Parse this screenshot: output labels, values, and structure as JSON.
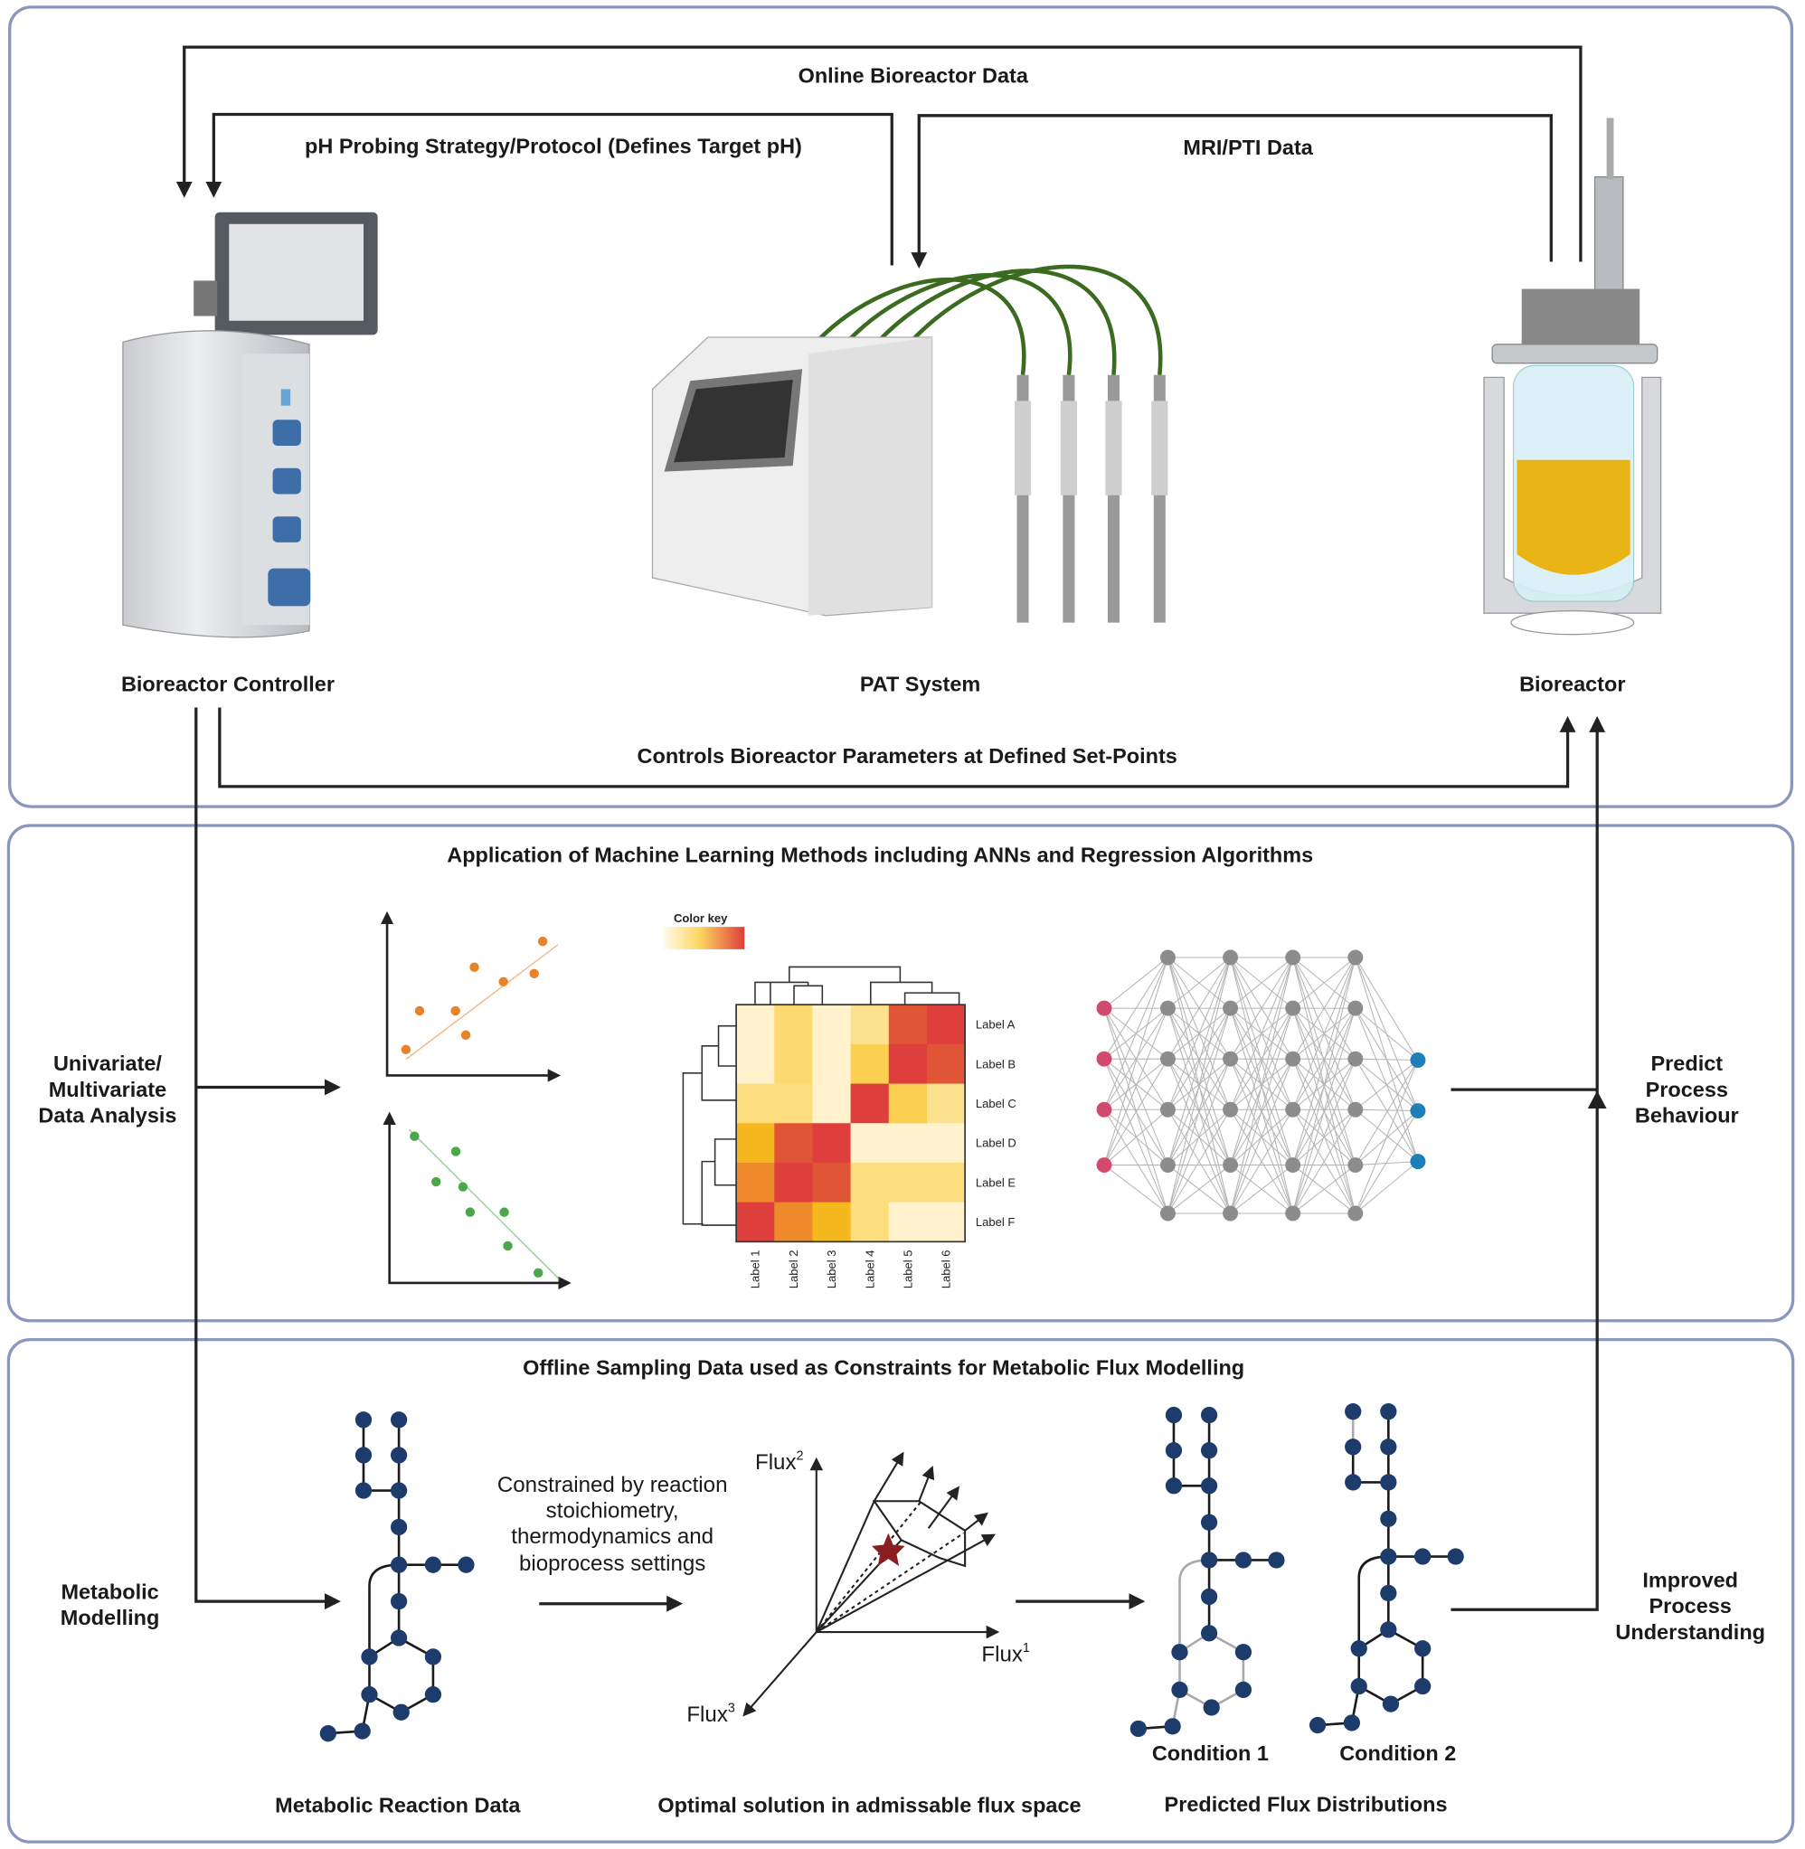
{
  "panels": {
    "top": {
      "arrows": {
        "online": "Online Bioreactor Data",
        "ph": "pH Probing Strategy/Protocol (Defines Target pH)",
        "mri": "MRI/PTI Data",
        "controls": "Controls Bioreactor Parameters at Defined Set-Points"
      },
      "devices": {
        "controller": "Bioreactor Controller",
        "pat": "PAT System",
        "bioreactor": "Bioreactor"
      }
    },
    "middle": {
      "title": "Application of Machine Learning Methods including ANNs and Regression Algorithms",
      "left_label": [
        "Univariate/",
        "Multivariate",
        "Data Analysis"
      ],
      "right_label": [
        "Predict",
        "Process",
        "Behaviour"
      ]
    },
    "bottom": {
      "title": "Offline Sampling Data used as Constraints for Metabolic Flux Modelling",
      "left_label": [
        "Metabolic",
        "Modelling"
      ],
      "right_label": [
        "Improved",
        "Process",
        "Understanding"
      ],
      "constraint_text": [
        "Constrained by reaction",
        "stoichiometry,",
        "thermodynamics and",
        "bioprocess settings"
      ],
      "flux_axes": {
        "x": "Flux",
        "x_sup": "1",
        "y": "Flux",
        "y_sup": "2",
        "z": "Flux",
        "z_sup": "3"
      },
      "conditions": [
        "Condition 1",
        "Condition 2"
      ],
      "captions": {
        "reaction": "Metabolic Reaction Data",
        "optimal": "Optimal solution in admissable flux space",
        "predicted": "Predicted Flux Distributions"
      }
    }
  },
  "chart_data": [
    {
      "type": "scatter",
      "title": "",
      "xlim": [
        0,
        10
      ],
      "ylim": [
        0,
        10
      ],
      "color": "#e8832b",
      "x": [
        1.1,
        1.9,
        4.0,
        4.6,
        5.1,
        6.8,
        8.6,
        9.1
      ],
      "y": [
        1.6,
        4.0,
        4.0,
        2.5,
        6.7,
        5.8,
        6.3,
        8.3
      ],
      "trend": [
        [
          1.1,
          1.0
        ],
        [
          10,
          8.1
        ]
      ]
    },
    {
      "type": "scatter",
      "title": "",
      "xlim": [
        0,
        10
      ],
      "ylim": [
        0,
        10
      ],
      "color": "#4aa84a",
      "x": [
        1.4,
        3.7,
        2.6,
        4.1,
        4.5,
        6.4,
        6.6,
        8.3
      ],
      "y": [
        8.7,
        7.8,
        6.0,
        5.7,
        4.2,
        4.2,
        2.2,
        0.6
      ],
      "trend": [
        [
          1.1,
          9.1
        ],
        [
          9.5,
          0.2
        ]
      ]
    },
    {
      "type": "heatmap",
      "legend_title": "Color key",
      "rows": [
        "Label A",
        "Label B",
        "Label C",
        "Label D",
        "Label E",
        "Label F"
      ],
      "columns": [
        "Label 1",
        "Label 2",
        "Label 3",
        "Label 4",
        "Label 5",
        "Label 6"
      ],
      "values": [
        [
          0.05,
          0.35,
          0.05,
          0.25,
          0.9,
          1.0
        ],
        [
          0.05,
          0.35,
          0.05,
          0.45,
          1.0,
          0.9
        ],
        [
          0.3,
          0.3,
          0.05,
          1.0,
          0.45,
          0.25
        ],
        [
          0.6,
          0.9,
          1.0,
          0.05,
          0.05,
          0.05
        ],
        [
          0.75,
          1.0,
          0.9,
          0.3,
          0.3,
          0.3
        ],
        [
          1.0,
          0.75,
          0.6,
          0.3,
          0.05,
          0.05
        ]
      ],
      "colorscale": [
        "#fff6dc",
        "#fcd65f",
        "#f6b81f",
        "#ee8a2a",
        "#e05535",
        "#de3f3c"
      ]
    }
  ],
  "neural_net": {
    "layers": [
      4,
      6,
      6,
      6,
      6,
      3
    ],
    "colors": {
      "input": "#d44a6c",
      "hidden": "#8c8c8c",
      "output": "#1f7fb6"
    }
  },
  "colors": {
    "panel_border": "#8a96bd",
    "node": "#1d3b6b",
    "cable": "#3a6b1f",
    "medium": "#e9b416",
    "star": "#8b1e1e"
  }
}
